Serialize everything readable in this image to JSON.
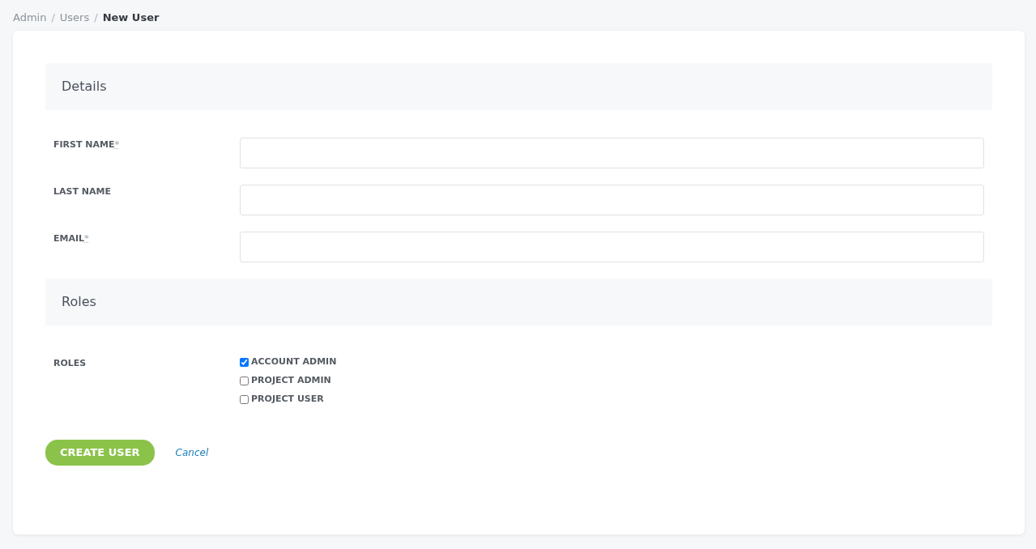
{
  "breadcrumb": [
    {
      "label": "Admin",
      "selected": false
    },
    {
      "separator": "/",
      "label": "Users",
      "selected": false
    },
    {
      "separator": "/",
      "label": "New User",
      "selected": true
    }
  ],
  "sections": [
    {
      "title": "Details",
      "kind": "fields",
      "fields": [
        {
          "label": "FIRST NAME",
          "required_mark": "*"
        },
        {
          "label": "LAST NAME"
        },
        {
          "label": "EMAIL",
          "required_mark": "*"
        }
      ]
    },
    {
      "title": "Roles",
      "kind": "checkboxes",
      "label": "ROLES",
      "options": [
        {
          "label": "ACCOUNT ADMIN",
          "checked": true
        },
        {
          "label": "PROJECT ADMIN",
          "checked": false
        },
        {
          "label": "PROJECT USER",
          "checked": false
        }
      ]
    }
  ],
  "actions": {
    "submit": "CREATE USER",
    "cancel": "Cancel"
  }
}
